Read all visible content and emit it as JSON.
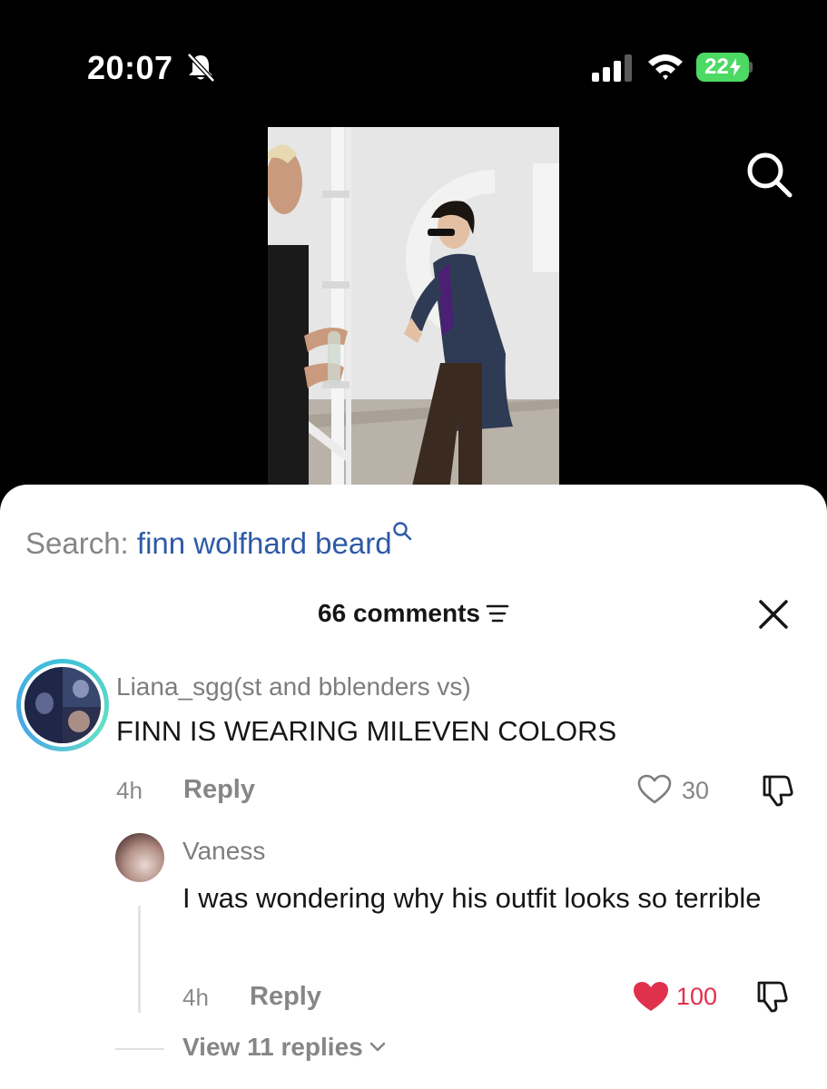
{
  "status_bar": {
    "time": "20:07",
    "battery": "22"
  },
  "search_bar": {
    "prefix": "Search:",
    "query": "finn wolfhard beard"
  },
  "comments_header": {
    "count_label": "66 comments"
  },
  "comments": [
    {
      "username": "Liana_sgg(st and bblenders vs)",
      "text": "FINN IS WEARING MILEVEN COLORS",
      "time": "4h",
      "reply_label": "Reply",
      "likes": "30"
    }
  ],
  "reply": {
    "username": "Vaness",
    "text": "I was wondering why his outfit looks so terrible",
    "time": "4h",
    "reply_label": "Reply",
    "likes": "100"
  },
  "view_replies_label": "View 11 replies",
  "colors": {
    "accent_link": "#2e5aa6",
    "liked_heart": "#fe2c55",
    "battery_green": "#4cd964",
    "story_ring": "#3fc1d8"
  }
}
